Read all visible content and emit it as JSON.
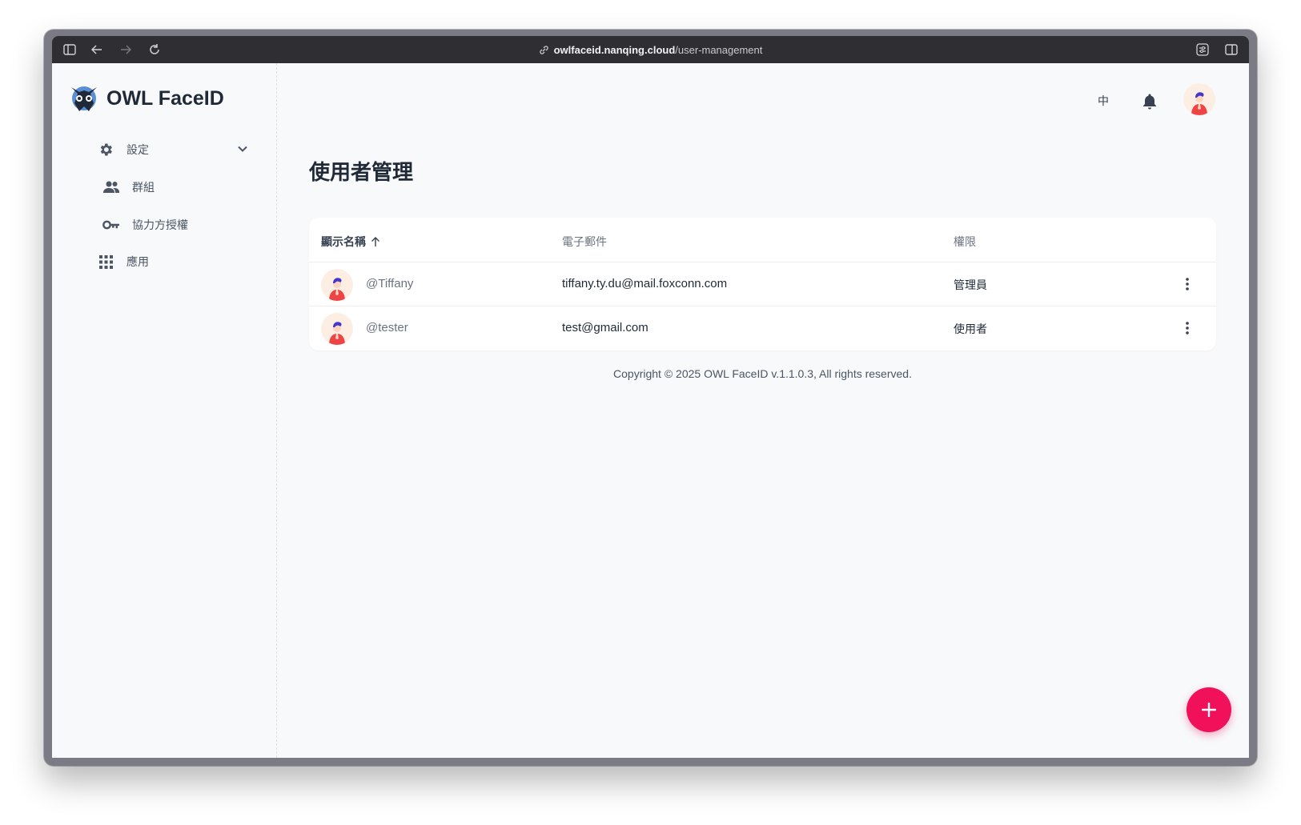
{
  "browser": {
    "url_host": "owlfaceid.nanqing.cloud",
    "url_path": "/user-management"
  },
  "app": {
    "brand_name": "OWL FaceID"
  },
  "sidebar": {
    "items": [
      {
        "label": "設定",
        "icon": "gear-icon",
        "expandable": true
      },
      {
        "label": "群組",
        "icon": "people-icon"
      },
      {
        "label": "協力方授權",
        "icon": "key-icon"
      },
      {
        "label": "應用",
        "icon": "grid-icon"
      }
    ]
  },
  "topbar": {
    "language_label": "中",
    "notifications_icon": "bell-icon",
    "avatar_icon": "user-avatar"
  },
  "page": {
    "title": "使用者管理"
  },
  "table": {
    "columns": [
      "顯示名稱",
      "電子郵件",
      "權限"
    ],
    "sort_icon": "arrow-up-icon",
    "rows": [
      {
        "name": "@Tiffany",
        "email": "tiffany.ty.du@mail.foxconn.com",
        "role": "管理員"
      },
      {
        "name": "@tester",
        "email": "test@gmail.com",
        "role": "使用者"
      }
    ]
  },
  "footer": {
    "copyright": "Copyright © 2025 OWL FaceID v.1.1.0.3, All rights reserved."
  },
  "fab": {
    "icon": "plus-icon",
    "color": "#f0115a"
  }
}
